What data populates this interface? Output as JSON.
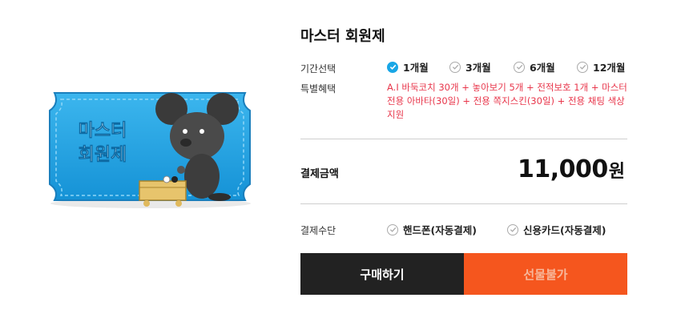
{
  "product": {
    "illustration_text_line1": "마스터",
    "illustration_text_line2": "회원제",
    "title": "마스터 회원제"
  },
  "period": {
    "label": "기간선택",
    "options": [
      {
        "label": "1개월",
        "selected": true
      },
      {
        "label": "3개월",
        "selected": false
      },
      {
        "label": "6개월",
        "selected": false
      },
      {
        "label": "12개월",
        "selected": false
      }
    ]
  },
  "benefits": {
    "label": "특별혜택",
    "text": "A.I 바둑코치 30개 + 놓아보기 5개 + 전적보호 1개 + 마스터 전용 아바타(30일) + 전용 쪽지스킨(30일) + 전용 채팅 색상 지원"
  },
  "payment_amount": {
    "label": "결제금액",
    "value": "11,000",
    "unit": "원"
  },
  "payment_method": {
    "label": "결제수단",
    "options": [
      {
        "label": "핸드폰(자동결제)",
        "selected": false
      },
      {
        "label": "신용카드(자동결제)",
        "selected": false
      }
    ]
  },
  "actions": {
    "buy_label": "구매하기",
    "gift_label": "선물불가"
  },
  "colors": {
    "accent_blue": "#19a6e6",
    "benefit_red": "#e8364b",
    "buy_bg": "#222222",
    "gift_bg": "#f5561e"
  }
}
